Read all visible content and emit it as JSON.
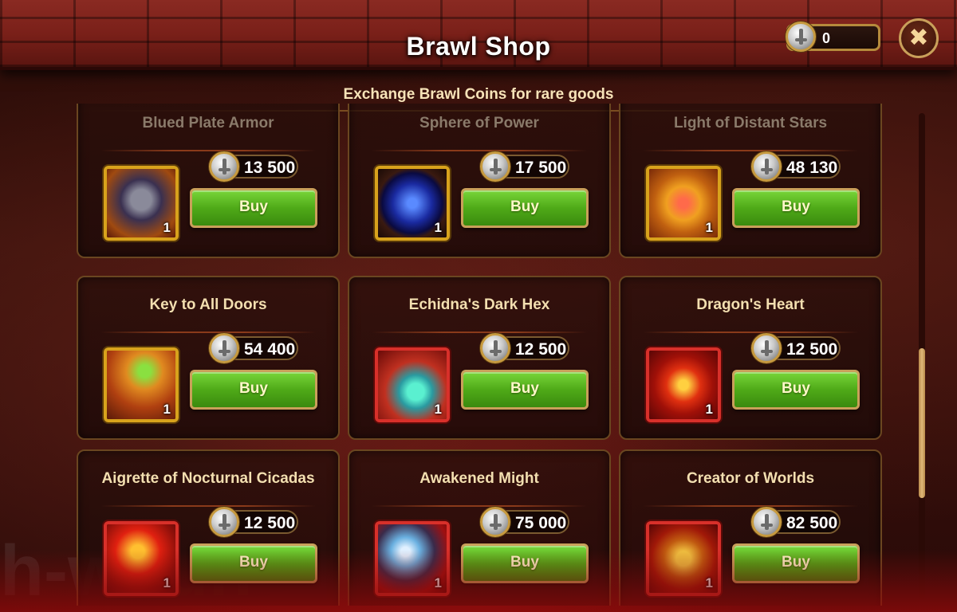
{
  "header": {
    "title": "Brawl Shop",
    "subtitle": "Exchange Brawl Coins for rare goods",
    "coin_balance": "0"
  },
  "watermark": "h-w.fun",
  "scroll": {
    "position_fraction": 0.7
  },
  "items": [
    {
      "name": "Blued Plate Armor",
      "price": "13 500",
      "qty": "1",
      "buy_label": "Buy",
      "frame": "gold",
      "icon": "armor-icon",
      "faded": true
    },
    {
      "name": "Sphere of Power",
      "price": "17 500",
      "qty": "1",
      "buy_label": "Buy",
      "frame": "gold",
      "icon": "blue-orb-icon",
      "faded": true
    },
    {
      "name": "Light of Distant Stars",
      "price": "48 130",
      "qty": "1",
      "buy_label": "Buy",
      "frame": "gold",
      "icon": "golden-medallion-icon",
      "faded": true
    },
    {
      "name": "Key to All Doors",
      "price": "54 400",
      "qty": "1",
      "buy_label": "Buy",
      "frame": "gold",
      "icon": "skeleton-key-icon",
      "faded": false
    },
    {
      "name": "Echidna's Dark Hex",
      "price": "12 500",
      "qty": "1",
      "buy_label": "Buy",
      "frame": "red",
      "icon": "potion-vial-icon",
      "faded": false
    },
    {
      "name": "Dragon's Heart",
      "price": "12 500",
      "qty": "1",
      "buy_label": "Buy",
      "frame": "red",
      "icon": "dragon-vase-icon",
      "faded": false
    },
    {
      "name": "Aigrette of Nocturnal Cicadas",
      "price": "12 500",
      "qty": "1",
      "buy_label": "Buy",
      "frame": "red",
      "icon": "hair-ornament-icon",
      "faded": false
    },
    {
      "name": "Awakened Might",
      "price": "75 000",
      "qty": "1",
      "buy_label": "Buy",
      "frame": "red",
      "icon": "crystal-claw-icon",
      "faded": false
    },
    {
      "name": "Creator of Worlds",
      "price": "82 500",
      "qty": "1",
      "buy_label": "Buy",
      "frame": "red",
      "icon": "jeweled-orb-icon",
      "faded": false
    }
  ]
}
